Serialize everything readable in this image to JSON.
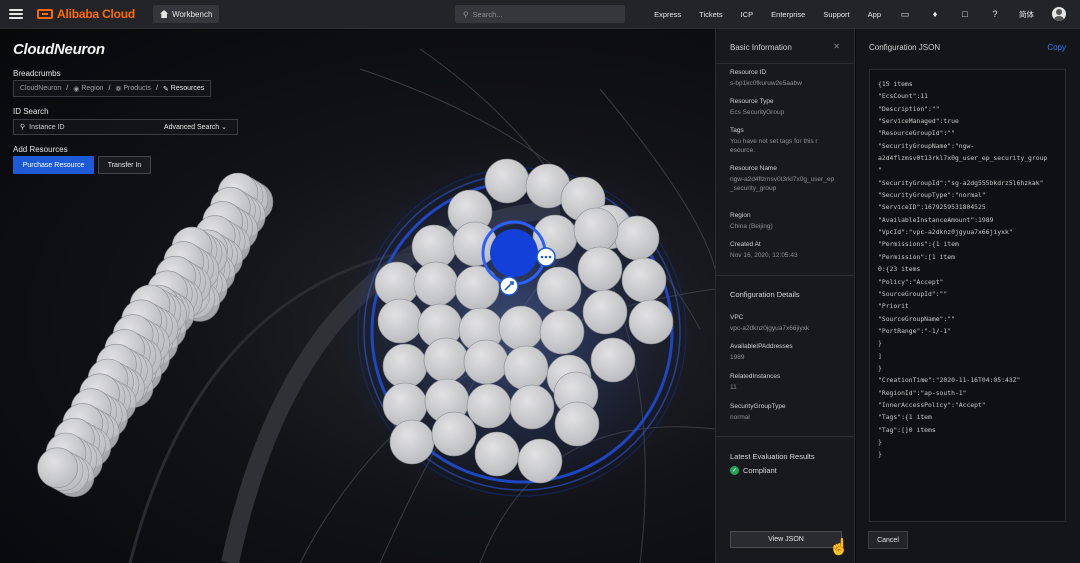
{
  "topbar": {
    "logo": "Alibaba Cloud",
    "workbench": "Workbench",
    "search_placeholder": "Search...",
    "nav": [
      "Express",
      "Tickets",
      "ICP",
      "Enterprise",
      "Support",
      "App"
    ],
    "language": "简体"
  },
  "stage": {
    "brand": "CloudNeuron",
    "breadcrumbs_label": "Breadcrumbs",
    "breadcrumbs": [
      "CloudNeuron",
      "Region",
      "Products",
      "Resources"
    ],
    "id_search_label": "ID Search",
    "id_search_placeholder": "Instance ID",
    "advanced_search": "Advanced Search",
    "add_resources_label": "Add Resources",
    "purchase_button": "Purchase Resource",
    "transfer_button": "Transfer In"
  },
  "info": {
    "title": "Basic Information",
    "fields": [
      {
        "key": "Resource ID",
        "value": "s-bp1kc0fkuruw2e5aabw"
      },
      {
        "key": "Resource Type",
        "value": "Ecs SecurityGroup"
      },
      {
        "key": "Tags",
        "value": "You have not set tags for this resource."
      },
      {
        "key": "Resource Name",
        "value": "ngw-a2d4flzmsv0t3rkl7x0g_user_ep_security_group"
      },
      {
        "key": "Region",
        "value": "China (Beijing)"
      },
      {
        "key": "Created At",
        "value": "Nov 16, 2020, 12:05:43"
      }
    ],
    "config_title": "Configuration Details",
    "config_fields": [
      {
        "key": "VPC",
        "value": "vpc-a2dknz0jgyua7x66jiyxk"
      },
      {
        "key": "AvailableIPAddresses",
        "value": "1989"
      },
      {
        "key": "RelatedInstances",
        "value": "11"
      },
      {
        "key": "SecurityGroupType",
        "value": "normal"
      }
    ],
    "eval_title": "Latest Evaluation Results",
    "eval_status": "Compliant",
    "view_json": "View JSON"
  },
  "config": {
    "title": "Configuration JSON",
    "copy": "Copy",
    "lines": [
      "{15 items",
      "\"EcsCount\":11",
      "\"Description\":\"\"",
      "\"ServiceManaged\":true",
      "\"ResourceGroupId\":\"\"",
      "\"SecurityGroupName\":\"ngw-",
      "a2d4flzmsv0t13rkl7x0g_user_ep_security_group",
      "\"",
      "\"SecurityGroupId\":\"sg-a2dg555bkdrz5l6hzkak\"",
      "\"SecurityGroupType\":\"normal\"",
      "\"ServiceID\":1679259531804525",
      "\"AvailableInstanceAmount\":1989",
      "\"VpcId\":\"vpc-a2dknz0jgyua7x66jiyxk\"",
      "\"Permissions\":{1 item",
      "\"Permission\":[1 item",
      "0:{23 items",
      "\"Policy\":\"Accept\"",
      "\"SourceGroupId\":\"\"",
      "\"Priorit",
      "\"SourceGroupName\":\"\"",
      "\"PortRange\":\"-1/-1\"",
      "",
      "}",
      "]",
      "}",
      "\"CreationTime\":\"2020-11-16T04:05:43Z\"",
      "\"RegionId\":\"ap-south-1\"",
      "\"InnerAccessPolicy\":\"Accept\"",
      "\"Tags\":{1 item",
      "\"Tag\":[]0 items",
      "}",
      "}"
    ],
    "cancel": "Cancel"
  },
  "colors": {
    "primary": "#1d5bd6",
    "accent": "#ff6a00",
    "selected_node": "#1240d8",
    "node": "#c8c8ca",
    "compliant": "#23a559"
  },
  "icons": [
    "menu-icon",
    "home-icon",
    "search-icon",
    "message-icon",
    "bell-icon",
    "cart-icon",
    "help-icon",
    "avatar",
    "globe-icon",
    "cube-icon",
    "resource-icon",
    "chevron-down-icon",
    "close-icon",
    "more-icon",
    "link-icon",
    "check-icon",
    "hand-cursor-icon"
  ]
}
